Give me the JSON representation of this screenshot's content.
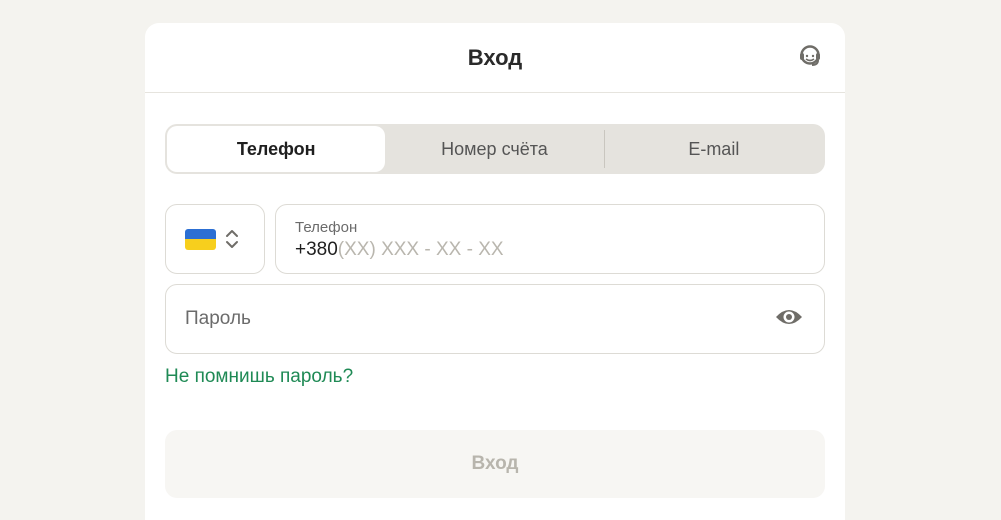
{
  "header": {
    "title": "Вход",
    "support_icon": "headset-icon"
  },
  "tabs": [
    {
      "label": "Телефон",
      "active": true
    },
    {
      "label": "Номер счёта",
      "active": false
    },
    {
      "label": "E-mail",
      "active": false
    }
  ],
  "country": {
    "flag": "ukraine-flag",
    "icon": "chevron-up-down-icon"
  },
  "phone": {
    "label": "Телефон",
    "prefix": "+380",
    "mask": "(XX) XXX - XX - XX"
  },
  "password": {
    "placeholder": "Пароль",
    "icon": "eye-icon"
  },
  "forgot_password": "Не помнишь пароль?",
  "submit": {
    "label": "Вход",
    "disabled": true
  },
  "colors": {
    "page_bg": "#f4f3ef",
    "card_bg": "#ffffff",
    "link": "#1f8a55",
    "tab_track": "#e5e3de",
    "disabled_text": "#b8b5ad"
  }
}
